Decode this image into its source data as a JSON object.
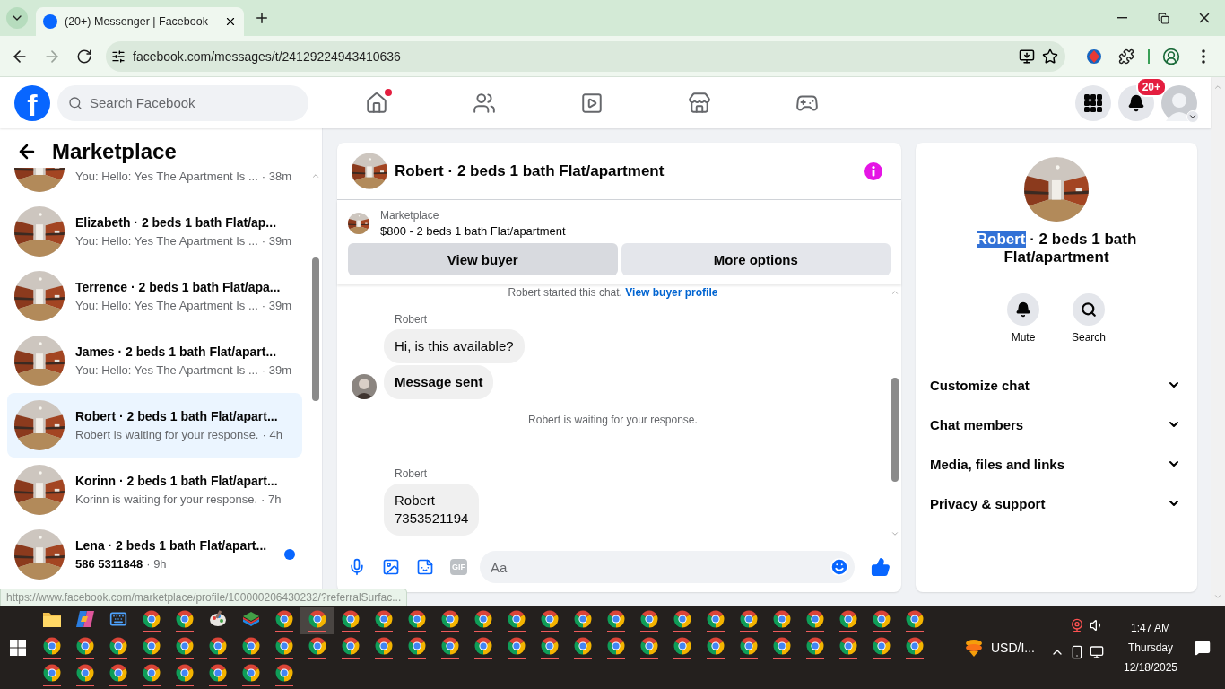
{
  "browser": {
    "tab_title": "(20+) Messenger | Facebook",
    "url": "facebook.com/messages/t/24129224943410636"
  },
  "header": {
    "logo_letter": "f",
    "search_placeholder": "Search Facebook",
    "nav": [
      {
        "kind": "home",
        "badge": true
      },
      {
        "kind": "friends",
        "badge": false
      },
      {
        "kind": "video",
        "badge": false
      },
      {
        "kind": "marketplace",
        "badge": false
      },
      {
        "kind": "gaming",
        "badge": false
      }
    ],
    "notification_badge": "20+"
  },
  "conversations": {
    "title": "Marketplace",
    "items": [
      {
        "preview": "You: Hello: Yes The Apartment Is ...",
        "time": "· 38m",
        "selected": false,
        "unread": false
      },
      {
        "title": "Elizabeth · 2 beds 1 bath Flat/ap...",
        "preview": "You: Hello: Yes The Apartment Is ...",
        "time": "· 39m",
        "selected": false,
        "unread": false
      },
      {
        "title": "Terrence · 2 beds 1 bath Flat/apa...",
        "preview": "You: Hello: Yes The Apartment Is ...",
        "time": "· 39m",
        "selected": false,
        "unread": false
      },
      {
        "title": "James · 2 beds 1 bath Flat/apart...",
        "preview": "You: Hello: Yes The Apartment Is ...",
        "time": "· 39m",
        "selected": false,
        "unread": false
      },
      {
        "title": "Robert · 2 beds 1 bath Flat/apart...",
        "preview": "Robert is waiting for your response.",
        "time": "· 4h",
        "selected": true,
        "unread": false
      },
      {
        "title": "Korinn · 2 beds 1 bath Flat/apart...",
        "preview": "Korinn is waiting for your response.",
        "time": "· 7h",
        "selected": false,
        "unread": false
      },
      {
        "title": "Lena · 2 beds 1 bath Flat/apart...",
        "preview": "586 5311848",
        "time": "· 9h",
        "selected": false,
        "unread": true
      }
    ]
  },
  "chat": {
    "title": "Robert · 2 beds 1 bath Flat/apartment",
    "listing": {
      "label": "Marketplace",
      "text": "$800 - 2 beds 1 bath Flat/apartment"
    },
    "buttons": [
      {
        "label": "View buyer",
        "hovered": true
      },
      {
        "label": "More options",
        "hovered": false
      }
    ],
    "intro": {
      "text": "Robert started this chat.",
      "link": "View buyer profile"
    },
    "messages": [
      {
        "kind": "group",
        "sender": "Robert",
        "bubbles": [
          {
            "text": "Hi, is this available?",
            "bold": false
          },
          {
            "text": "Message sent",
            "bold": true
          }
        ]
      },
      {
        "kind": "system",
        "text": "Robert is waiting for your response."
      },
      {
        "kind": "group",
        "sender": "Robert",
        "bubbles": [
          {
            "text": "Robert\n7353521194",
            "bold": false
          }
        ]
      }
    ],
    "composer": {
      "gif_label": "GIF",
      "placeholder": "Aa"
    }
  },
  "details": {
    "title": [
      {
        "text": "Robert",
        "selected": true
      },
      {
        "text": " · 2 beds 1 bath Flat/apartment",
        "selected": false
      }
    ],
    "actions": [
      {
        "kind": "mute",
        "label": "Mute"
      },
      {
        "kind": "search",
        "label": "Search"
      }
    ],
    "sections": [
      {
        "label": "Customize chat",
        "expanded": false
      },
      {
        "label": "Chat members",
        "expanded": false
      },
      {
        "label": "Media, files and links",
        "expanded": false
      },
      {
        "label": "Privacy & support",
        "expanded": false
      }
    ]
  },
  "status_link": "https://www.facebook.com/marketplace/profile/100000206430232/?referralSurfac...",
  "taskbar": {
    "rows": [
      [
        {
          "kind": "folder",
          "selected": false
        },
        {
          "kind": "copilot",
          "selected": false
        },
        {
          "kind": "keyboard",
          "selected": false
        },
        {
          "kind": "chrome",
          "selected": false
        },
        {
          "kind": "chrome",
          "selected": false
        },
        {
          "kind": "paint",
          "selected": false
        },
        {
          "kind": "stack",
          "selected": false
        },
        {
          "kind": "chrome",
          "selected": false
        },
        {
          "kind": "chrome",
          "selected": true
        },
        {
          "kind": "chrome",
          "selected": false
        },
        {
          "kind": "chrome",
          "selected": false
        },
        {
          "kind": "chrome",
          "selected": false
        },
        {
          "kind": "chrome",
          "selected": false
        },
        {
          "kind": "chrome",
          "selected": false
        },
        {
          "kind": "chrome",
          "selected": false
        },
        {
          "kind": "chrome",
          "selected": false
        },
        {
          "kind": "chrome",
          "selected": false
        },
        {
          "kind": "chrome",
          "selected": false
        },
        {
          "kind": "chrome",
          "selected": false
        },
        {
          "kind": "chrome",
          "selected": false
        },
        {
          "kind": "chrome",
          "selected": false
        },
        {
          "kind": "chrome",
          "selected": false
        },
        {
          "kind": "chrome",
          "selected": false
        },
        {
          "kind": "chrome",
          "selected": false
        },
        {
          "kind": "chrome",
          "selected": false
        },
        {
          "kind": "chrome",
          "selected": false
        },
        {
          "kind": "chrome",
          "selected": false
        }
      ],
      [
        {
          "kind": "chrome",
          "selected": false
        },
        {
          "kind": "chrome",
          "selected": false
        },
        {
          "kind": "chrome",
          "selected": false
        },
        {
          "kind": "chrome",
          "selected": false
        },
        {
          "kind": "chrome",
          "selected": false
        },
        {
          "kind": "chrome",
          "selected": false
        },
        {
          "kind": "chrome",
          "selected": false
        },
        {
          "kind": "chrome",
          "selected": false
        },
        {
          "kind": "chrome",
          "selected": false
        },
        {
          "kind": "chrome",
          "selected": false
        },
        {
          "kind": "chrome",
          "selected": false
        },
        {
          "kind": "chrome",
          "selected": false
        },
        {
          "kind": "chrome",
          "selected": false
        },
        {
          "kind": "chrome",
          "selected": false
        },
        {
          "kind": "chrome",
          "selected": false
        },
        {
          "kind": "chrome",
          "selected": false
        },
        {
          "kind": "chrome",
          "selected": false
        },
        {
          "kind": "chrome",
          "selected": false
        },
        {
          "kind": "chrome",
          "selected": false
        },
        {
          "kind": "chrome",
          "selected": false
        },
        {
          "kind": "chrome",
          "selected": false
        },
        {
          "kind": "chrome",
          "selected": false
        },
        {
          "kind": "chrome",
          "selected": false
        },
        {
          "kind": "chrome",
          "selected": false
        },
        {
          "kind": "chrome",
          "selected": false
        },
        {
          "kind": "chrome",
          "selected": false
        },
        {
          "kind": "chrome",
          "selected": false
        }
      ],
      [
        {
          "kind": "chrome",
          "selected": false
        },
        {
          "kind": "chrome",
          "selected": false
        },
        {
          "kind": "chrome",
          "selected": false
        },
        {
          "kind": "chrome",
          "selected": false
        },
        {
          "kind": "chrome",
          "selected": false
        },
        {
          "kind": "chrome",
          "selected": false
        },
        {
          "kind": "chrome",
          "selected": false
        },
        {
          "kind": "chrome",
          "selected": false
        }
      ]
    ],
    "tray": {
      "currency": "USD/I...",
      "time": "1:47 AM",
      "day": "Thursday",
      "date": "12/18/2025"
    }
  }
}
